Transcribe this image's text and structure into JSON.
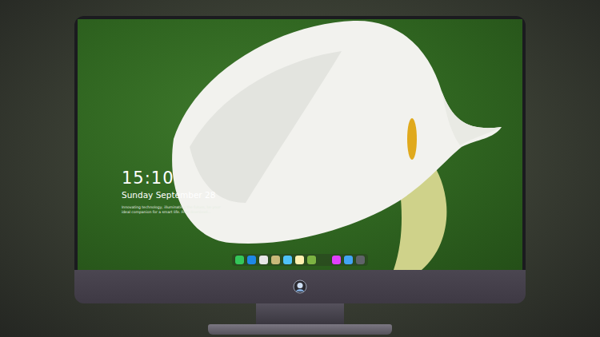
{
  "lock_screen": {
    "time": "15:10",
    "date": "Sunday September 28",
    "tagline": [
      "Innovating technology, illuminating the future, be your",
      "ideal companion for a smart life. Free download..."
    ]
  },
  "dock": {
    "apps": [
      {
        "color": "#34c759"
      },
      {
        "color": "#1e88e5"
      },
      {
        "color": "#e6e6e6"
      },
      {
        "color": "#c9b97a"
      },
      {
        "color": "#4fc3f7"
      },
      {
        "color": "#fff1b0"
      },
      {
        "color": "#7cb342"
      }
    ],
    "recent": [
      {
        "color": "#e040fb"
      },
      {
        "color": "#42a5f5"
      },
      {
        "color": "#5f6368"
      }
    ]
  }
}
